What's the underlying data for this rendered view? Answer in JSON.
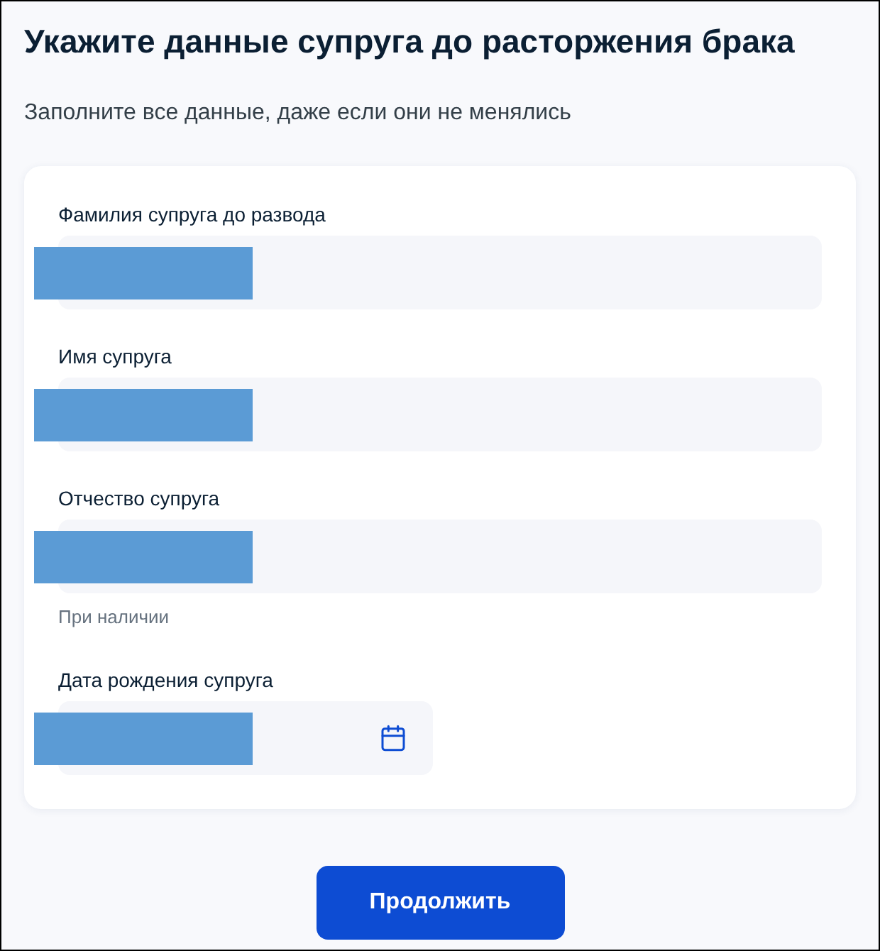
{
  "page": {
    "title": "Укажите данные супруга до расторжения брака",
    "subtitle": "Заполните все данные, даже если они не менялись"
  },
  "form": {
    "fields": [
      {
        "kind": "text",
        "label": "Фамилия супруга до развода",
        "redacted": true
      },
      {
        "kind": "text",
        "label": "Имя супруга",
        "redacted": true
      },
      {
        "kind": "text",
        "label": "Отчество супруга",
        "redacted": true,
        "hint": "При наличии"
      },
      {
        "kind": "date",
        "label": "Дата рождения супруга",
        "redacted": true
      }
    ]
  },
  "buttons": [
    {
      "label": "Продолжить"
    }
  ]
}
